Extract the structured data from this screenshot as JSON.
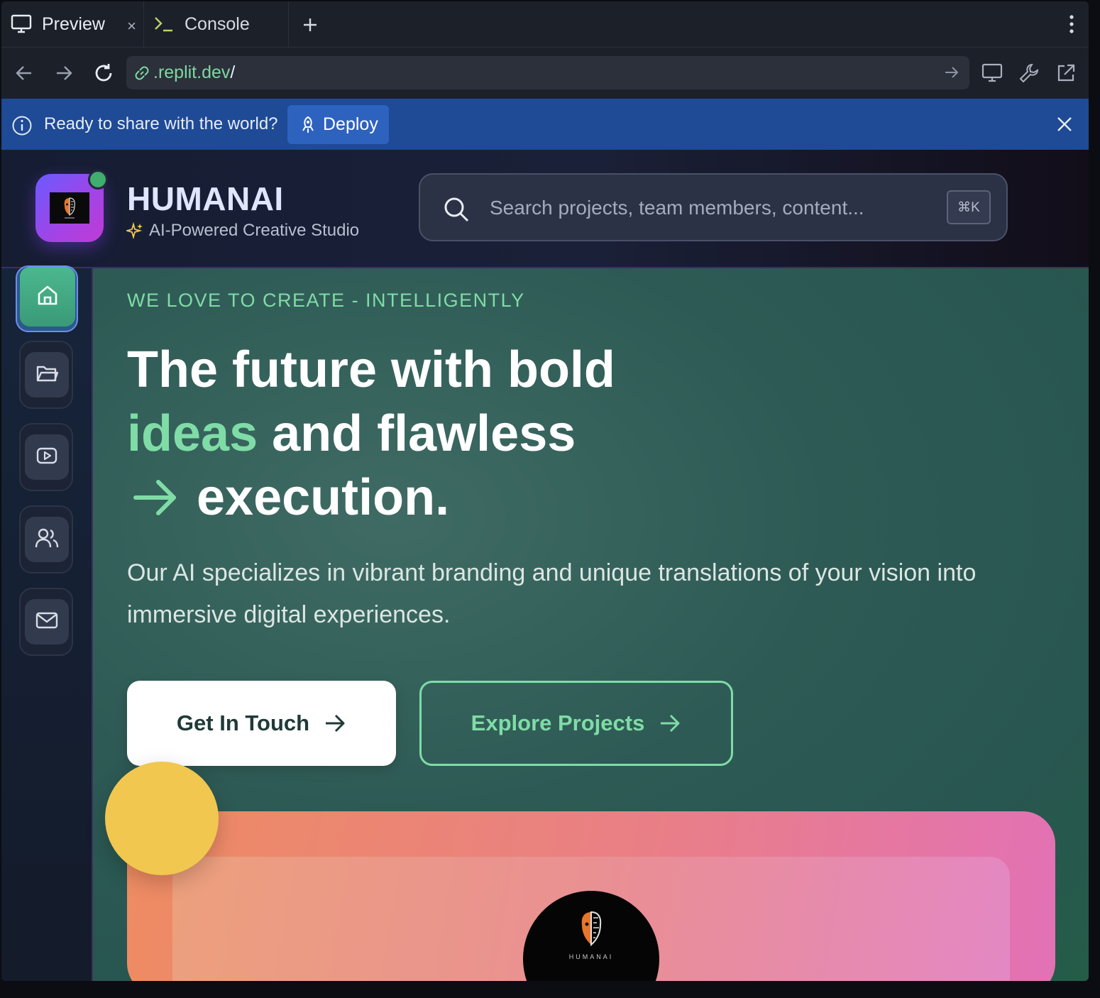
{
  "browser": {
    "tabs": [
      {
        "label": "Preview",
        "icon": "monitor-icon"
      },
      {
        "label": "Console",
        "icon": "terminal-icon"
      }
    ],
    "tab_close": "×",
    "add_tab": "+",
    "url": {
      "host": ".replit.dev",
      "path": "/"
    },
    "colors": {
      "chrome": "#1c2029",
      "url_host": "#7fd6a0"
    }
  },
  "banner": {
    "message": "Ready to share with the world?",
    "deploy_label": "Deploy",
    "color": "#1e4a96"
  },
  "app": {
    "brand": "HUMANAI",
    "tagline": "AI-Powered Creative Studio",
    "search": {
      "placeholder": "Search projects, team members, content...",
      "shortcut": "⌘K"
    },
    "status": "online",
    "logo_word": "HUMANAI"
  },
  "sidebar": {
    "items": [
      {
        "name": "home",
        "icon": "home-icon",
        "active": true
      },
      {
        "name": "projects",
        "icon": "folder-icon",
        "active": false
      },
      {
        "name": "videos",
        "icon": "play-icon",
        "active": false
      },
      {
        "name": "team",
        "icon": "users-icon",
        "active": false
      },
      {
        "name": "contact",
        "icon": "mail-icon",
        "active": false
      }
    ]
  },
  "hero": {
    "kicker": "WE LOVE TO CREATE - INTELLIGENTLY",
    "headline_line1": "The future with bold",
    "headline_highlight": "ideas",
    "headline_line2_rest": "and flawless",
    "headline_line3": "execution.",
    "lede": "Our AI specializes in vibrant branding and unique translations of your vision into immersive digital experiences.",
    "primary_cta": "Get In Touch",
    "secondary_cta": "Explore Projects",
    "accent": "#7fdca6",
    "card_word": "HUMANAI"
  }
}
